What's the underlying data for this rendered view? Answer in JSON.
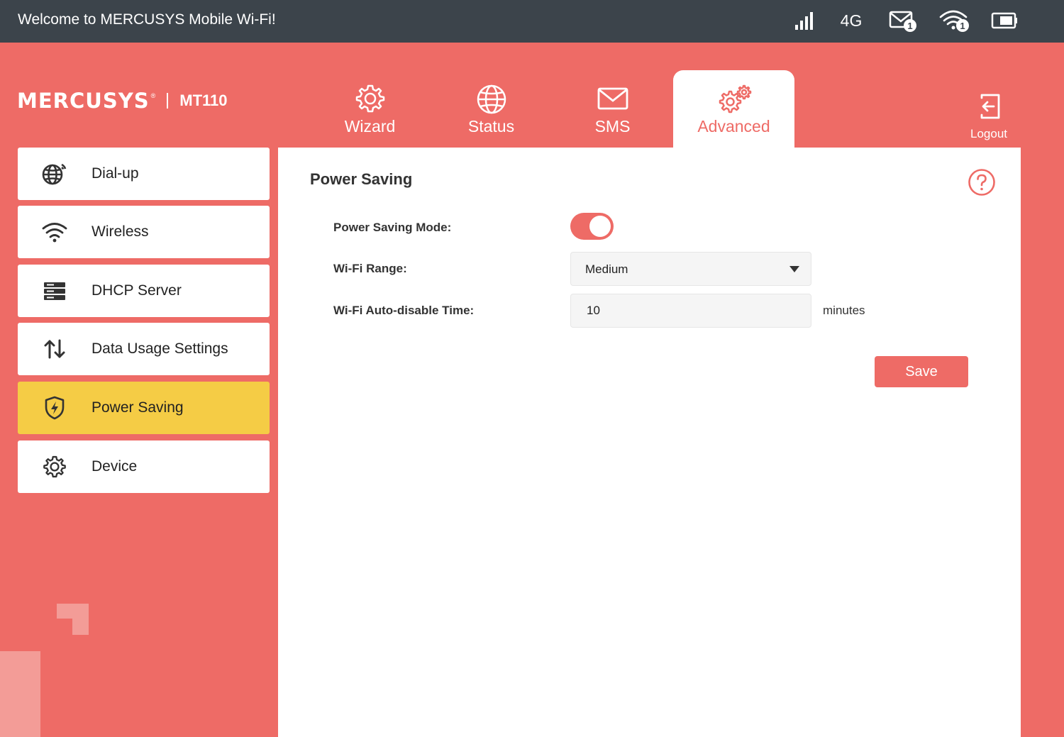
{
  "topbar": {
    "welcome": "Welcome to MERCUSYS Mobile Wi-Fi!",
    "network_type": "4G",
    "sms_unread": "1",
    "wifi_clients": "1"
  },
  "brand": {
    "logo": "MERCUSYS",
    "trademark": "®",
    "model": "MT110"
  },
  "tabs": [
    {
      "label": "Wizard",
      "icon": "gear-icon"
    },
    {
      "label": "Status",
      "icon": "globe-icon"
    },
    {
      "label": "SMS",
      "icon": "envelope-icon"
    },
    {
      "label": "Advanced",
      "icon": "gears-icon",
      "active": true
    }
  ],
  "logout": {
    "label": "Logout"
  },
  "sidebar": {
    "items": [
      {
        "label": "Dial-up",
        "icon": "globe-signal-icon"
      },
      {
        "label": "Wireless",
        "icon": "wifi-icon"
      },
      {
        "label": "DHCP Server",
        "icon": "server-icon"
      },
      {
        "label": "Data Usage Settings",
        "icon": "up-down-arrows-icon"
      },
      {
        "label": "Power Saving",
        "icon": "shield-bolt-icon",
        "active": true
      },
      {
        "label": "Device",
        "icon": "gear-icon"
      }
    ]
  },
  "content": {
    "title": "Power Saving",
    "fields": {
      "power_saving_mode_label": "Power Saving Mode:",
      "power_saving_mode_on": true,
      "wifi_range_label": "Wi-Fi Range:",
      "wifi_range_value": "Medium",
      "auto_disable_label": "Wi-Fi Auto-disable Time:",
      "auto_disable_value": "10",
      "auto_disable_unit": "minutes"
    },
    "save_label": "Save"
  },
  "colors": {
    "accent": "#ee6b66",
    "topbar": "#3c444b",
    "active_side": "#f5cc45"
  }
}
